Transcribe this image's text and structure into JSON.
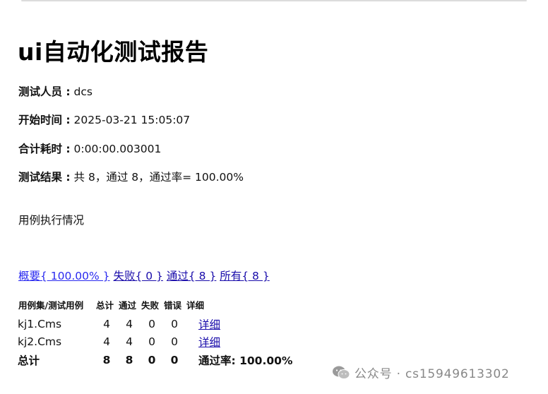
{
  "report": {
    "title": "ui自动化测试报告",
    "tester_label": "测试人员 :",
    "tester_value": " dcs",
    "start_label": "开始时间 :",
    "start_value": " 2025-03-21 15:05:07",
    "duration_label": "合计耗时 :",
    "duration_value": " 0:00:00.003001",
    "result_label": "测试结果 :",
    "result_value": " 共 8，通过 8，通过率= 100.00%",
    "section_title": "用例执行情况"
  },
  "filters": {
    "summary": "概要{ 100.00% }",
    "failed": "失败{ 0 }",
    "passed": "通过{ 8 }",
    "all": "所有{ 8 }"
  },
  "table": {
    "headers": [
      "用例集/测试用例",
      "总计",
      "通过",
      "失败",
      "错误",
      "详细"
    ],
    "rows": [
      {
        "name": "kj1.Cms",
        "total": "4",
        "pass": "4",
        "fail": "0",
        "error": "0",
        "detail": "详细"
      },
      {
        "name": "kj2.Cms",
        "total": "4",
        "pass": "4",
        "fail": "0",
        "error": "0",
        "detail": "详细"
      }
    ],
    "totals": {
      "name": "总计",
      "total": "8",
      "pass": "8",
      "fail": "0",
      "error": "0",
      "rate": "通过率:  100.00%"
    }
  },
  "watermark": {
    "text": "公众号 · cs15949613302",
    "icon": "wechat-icon"
  },
  "colors": {
    "link": "#1a0dab",
    "watermark": "#888888"
  }
}
